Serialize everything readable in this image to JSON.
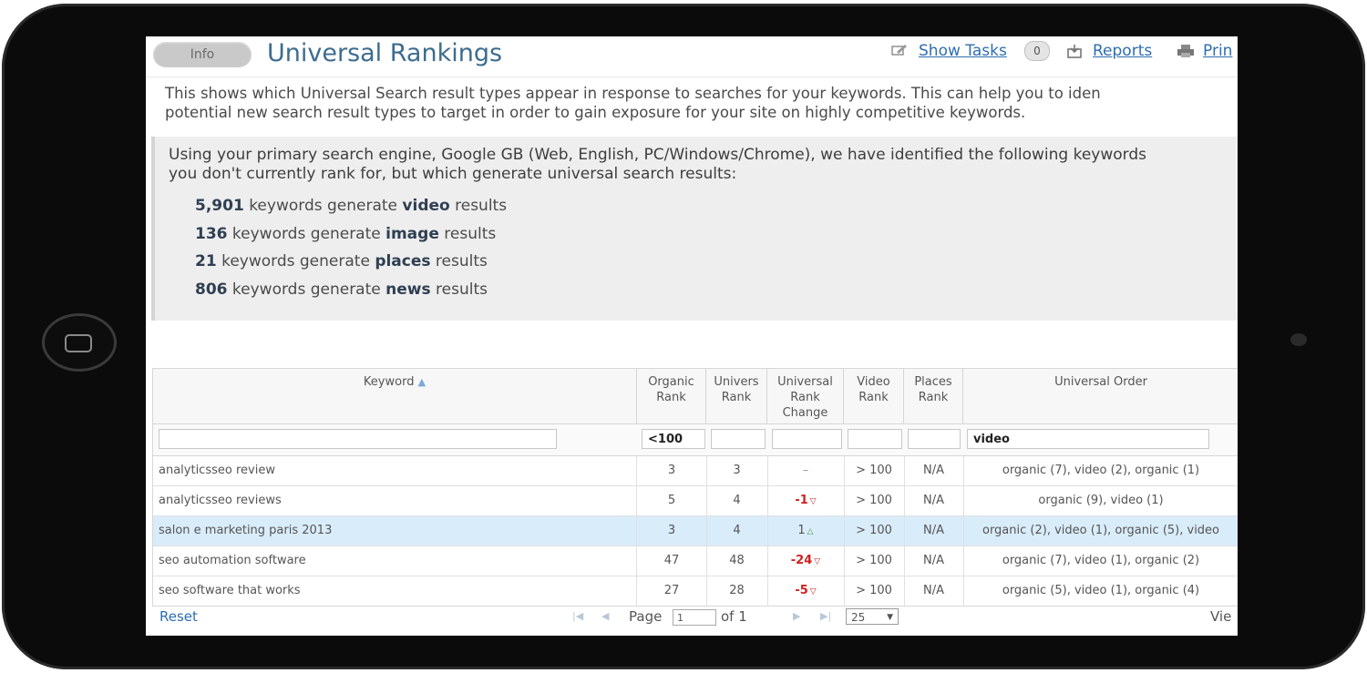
{
  "toolbar": {
    "info_label": "Info",
    "title": "Universal Rankings",
    "show_tasks_label": "Show Tasks",
    "tasks_count": "0",
    "reports_label": "Reports",
    "print_label": "Prin"
  },
  "description": {
    "line1": "This shows which Universal Search result types appear in response to searches for your keywords. This can help you to iden",
    "line2": "potential new search result types to target in order to gain exposure for your site on highly competitive keywords."
  },
  "summary": {
    "intro_line1": "Using your primary search engine, Google GB (Web, English, PC/Windows/Chrome), we have identified the following keywords",
    "intro_line2": "you don't currently rank for, but which generate universal search results:",
    "stats": [
      {
        "count": "5,901",
        "pre": "keywords generate",
        "type": "video",
        "post": "results"
      },
      {
        "count": "136",
        "pre": "keywords generate",
        "type": "image",
        "post": "results"
      },
      {
        "count": "21",
        "pre": "keywords generate",
        "type": "places",
        "post": "results"
      },
      {
        "count": "806",
        "pre": "keywords generate",
        "type": "news",
        "post": "results"
      }
    ]
  },
  "table": {
    "headers": {
      "keyword": "Keyword",
      "organic_rank": [
        "Organic",
        "Rank"
      ],
      "universal_rank": [
        "Univers",
        "Rank"
      ],
      "universal_rank_change": [
        "Universal",
        "Rank",
        "Change"
      ],
      "video_rank": [
        "Video",
        "Rank"
      ],
      "places_rank": [
        "Places",
        "Rank"
      ],
      "universal_order": "Universal Order"
    },
    "filters": {
      "keyword": "",
      "organic_rank": "<100",
      "universal_rank": "",
      "universal_rank_change": "",
      "video_rank": "",
      "places_rank": "",
      "universal_order": "video"
    },
    "rows": [
      {
        "keyword": "analyticsseo review",
        "organic": "3",
        "universal": "3",
        "change": "–",
        "video": "> 100",
        "places": "N/A",
        "order": "organic (7), video (2), organic (1)"
      },
      {
        "keyword": "analyticsseo reviews",
        "organic": "5",
        "universal": "4",
        "change": "-1",
        "video": "> 100",
        "places": "N/A",
        "order": "organic (9), video (1)"
      },
      {
        "keyword": "salon e marketing paris 2013",
        "organic": "3",
        "universal": "4",
        "change": "1",
        "video": "> 100",
        "places": "N/A",
        "order": "organic (2), video (1), organic (5), video"
      },
      {
        "keyword": "seo automation software",
        "organic": "47",
        "universal": "48",
        "change": "-24",
        "video": "> 100",
        "places": "N/A",
        "order": "organic (7), video (1), organic (2)"
      },
      {
        "keyword": "seo software that works",
        "organic": "27",
        "universal": "28",
        "change": "-5",
        "video": "> 100",
        "places": "N/A",
        "order": "organic (5), video (1), organic (4)"
      }
    ]
  },
  "pager": {
    "reset_label": "Reset",
    "page_label": "Page",
    "page_value": "1",
    "of_label": "of 1",
    "page_size": "25",
    "view_label": "Vie"
  },
  "icons": {
    "sort": "sort-asc-icon",
    "first": "first-page-icon",
    "prev": "prev-page-icon",
    "next": "next-page-icon",
    "last": "last-page-icon"
  },
  "colors": {
    "title": "#3d6c8f",
    "link": "#2e6db0",
    "negative": "#d02020",
    "selected_row": "#d9ecfa"
  }
}
